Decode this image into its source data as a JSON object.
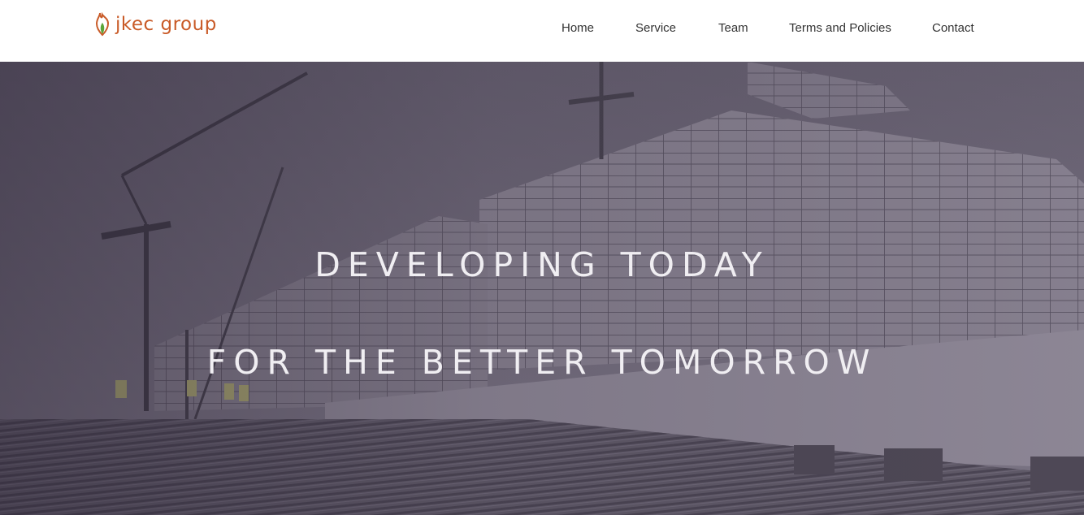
{
  "header": {
    "logo": {
      "text": "jkec group",
      "icon": "flame-leaf-icon"
    },
    "nav": [
      {
        "label": "Home"
      },
      {
        "label": "Service"
      },
      {
        "label": "Team"
      },
      {
        "label": "Terms and Policies"
      },
      {
        "label": "Contact"
      }
    ]
  },
  "hero": {
    "headline_line1": "DEVELOPING TODAY",
    "headline_line2": "FOR THE BETTER TOMORROW",
    "background_image": "construction-site-with-cranes-and-scaffolding"
  },
  "colors": {
    "brand_orange": "#c95b28",
    "brand_green": "#5aa53a",
    "nav_text": "#333333",
    "hero_text": "#f0eef2"
  }
}
